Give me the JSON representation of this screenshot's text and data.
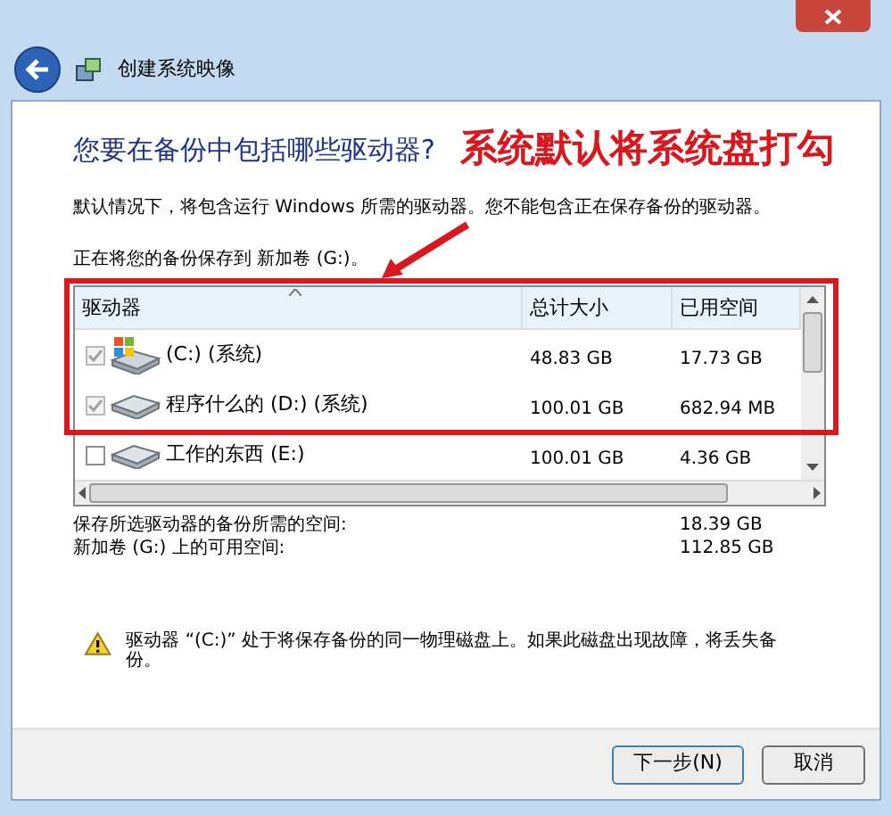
{
  "window": {
    "title": "创建系统映像"
  },
  "heading": "您要在备份中包括哪些驱动器?",
  "intro": "默认情况下，将包含运行 Windows 所需的驱动器。您不能包含正在保存备份的驱动器。",
  "destination": "正在将您的备份保存到 新加卷 (G:)。",
  "table": {
    "columns": [
      "驱动器",
      "总计大小",
      "已用空间"
    ],
    "rows": [
      {
        "kind": "system",
        "checked": true,
        "disabled": true,
        "name": "(C:) (系统)",
        "total": "48.83 GB",
        "used": "17.73 GB"
      },
      {
        "kind": "plain",
        "checked": true,
        "disabled": true,
        "name": "程序什么的 (D:) (系统)",
        "total": "100.01 GB",
        "used": "682.94 MB"
      },
      {
        "kind": "plain",
        "checked": false,
        "disabled": false,
        "name": "工作的东西 (E:)",
        "total": "100.01 GB",
        "used": "4.36 GB"
      }
    ]
  },
  "summary": [
    {
      "label": "保存所选驱动器的备份所需的空间:",
      "value": "18.39 GB"
    },
    {
      "label": "新加卷 (G:) 上的可用空间:",
      "value": "112.85 GB"
    }
  ],
  "warning": "驱动器 “(C:)” 处于将保存备份的同一物理磁盘上。如果此磁盘出现故障，将丢失备份。",
  "buttons": [
    "下一步(N)",
    "取消"
  ],
  "annotation": {
    "text": "系统默认将系统盘打勾"
  }
}
